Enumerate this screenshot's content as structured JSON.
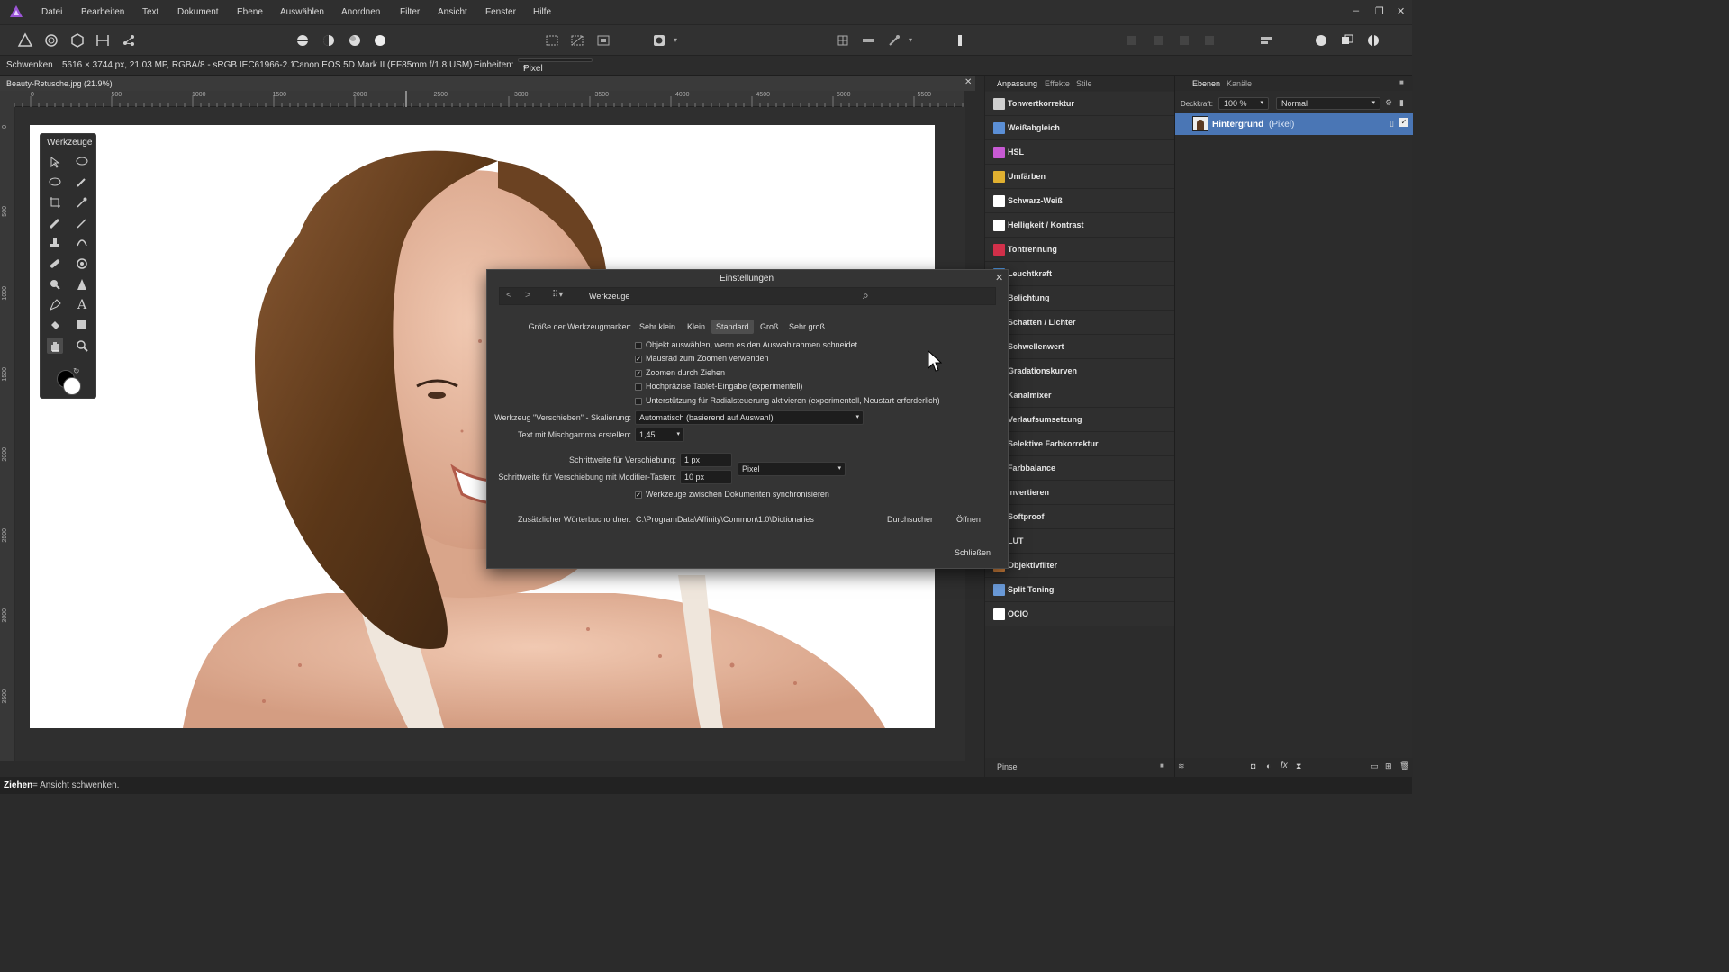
{
  "menu": [
    "Datei",
    "Bearbeiten",
    "Text",
    "Dokument",
    "Ebene",
    "Auswählen",
    "Anordnen",
    "Filter",
    "Ansicht",
    "Fenster",
    "Hilfe"
  ],
  "context": {
    "tool": "Schwenken",
    "info": "5616 × 3744 px, 21.03 MP, RGBA/8 - sRGB IEC61966-2.1",
    "camera": "Canon EOS 5D Mark II (EF85mm f/1.8 USM)",
    "units_label": "Einheiten:",
    "units_value": "Pixel"
  },
  "document_tab": "Beauty-Retusche.jpg (21.9%)",
  "ruler_ticks": [
    "0",
    "500",
    "1000",
    "1500",
    "2000",
    "2500",
    "3000",
    "3500",
    "4000",
    "4500",
    "5000",
    "5500"
  ],
  "ruler_v_ticks": [
    "0",
    "500",
    "1000",
    "1500",
    "2000",
    "2500",
    "3000",
    "3500"
  ],
  "tools_panel": {
    "title": "Werkzeuge"
  },
  "adjustment_panel": {
    "tabs": [
      "Anpassung",
      "Effekte",
      "Stile"
    ],
    "items": [
      {
        "label": "Tonwertkorrektur",
        "color": "#cfcfcf"
      },
      {
        "label": "Weißabgleich",
        "color": "#5b8fd6"
      },
      {
        "label": "HSL",
        "color": "#c85ad4"
      },
      {
        "label": "Umfärben",
        "color": "#e0b030"
      },
      {
        "label": "Schwarz-Weiß",
        "color": "#ffffff"
      },
      {
        "label": "Helligkeit / Kontrast",
        "color": "#ffffff"
      },
      {
        "label": "Tontrennung",
        "color": "#d2304a"
      },
      {
        "label": "Leuchtkraft",
        "color": "#4a90d9"
      },
      {
        "label": "Belichtung",
        "color": "#888888"
      },
      {
        "label": "Schatten / Lichter",
        "color": "#777777"
      },
      {
        "label": "Schwellenwert",
        "color": "#999999"
      },
      {
        "label": "Gradationskurven",
        "color": "#7ab0e0"
      },
      {
        "label": "Kanalmixer",
        "color": "#c04040"
      },
      {
        "label": "Verlaufsumsetzung",
        "color": "#b06ad0"
      },
      {
        "label": "Selektive Farbkorrektur",
        "color": "#e0a040"
      },
      {
        "label": "Farbbalance",
        "color": "#50a060"
      },
      {
        "label": "Invertieren",
        "color": "#cccccc"
      },
      {
        "label": "Softproof",
        "color": "#6080c0"
      },
      {
        "label": "LUT",
        "color": "#a0a0a0"
      },
      {
        "label": "Objektivfilter",
        "color": "#e08a40"
      },
      {
        "label": "Split Toning",
        "color": "#6a9ad8"
      },
      {
        "label": "OCIO",
        "color": "#ffffff"
      }
    ],
    "footer": "Pinsel"
  },
  "layers_panel": {
    "tabs": [
      "Ebenen",
      "Kanäle"
    ],
    "opacity_label": "Deckkraft:",
    "opacity_value": "100 %",
    "blend_mode": "Normal",
    "layer_name": "Hintergrund",
    "layer_type": "(Pixel)"
  },
  "dialog": {
    "title": "Einstellungen",
    "section": "Werkzeuge",
    "size_label": "Größe der Werkzeugmarker:",
    "sizes": [
      "Sehr klein",
      "Klein",
      "Standard",
      "Groß",
      "Sehr groß"
    ],
    "checkboxes": [
      {
        "label": "Objekt auswählen, wenn es den Auswahlrahmen schneidet",
        "checked": false
      },
      {
        "label": "Mausrad zum Zoomen verwenden",
        "checked": true
      },
      {
        "label": "Zoomen durch Ziehen",
        "checked": true
      },
      {
        "label": "Hochpräzise Tablet-Eingabe (experimentell)",
        "checked": false
      },
      {
        "label": "Unterstützung für Radialsteuerung aktivieren (experimentell, Neustart erforderlich)",
        "checked": false
      }
    ],
    "move_scale_label": "Werkzeug \"Verschieben\" - Skalierung:",
    "move_scale_value": "Automatisch (basierend auf Auswahl)",
    "gamma_label": "Text mit Mischgamma erstellen:",
    "gamma_value": "1,45",
    "nudge_label": "Schrittweite für Verschiebung:",
    "nudge_value": "1 px",
    "nudge_unit": "Pixel",
    "nudge_mod_label": "Schrittweite für Verschiebung mit Modifier-Tasten:",
    "nudge_mod_value": "10 px",
    "sync_label": "Werkzeuge zwischen Dokumenten synchronisieren",
    "dict_label": "Zusätzlicher Wörterbuchordner:",
    "dict_path": "C:\\ProgramData\\Affinity\\Common\\1.0\\Dictionaries",
    "browse": "Durchsucher",
    "open": "Öffnen",
    "close": "Schließen"
  },
  "status": {
    "bold": "Ziehen",
    "rest": " = Ansicht schwenken."
  }
}
